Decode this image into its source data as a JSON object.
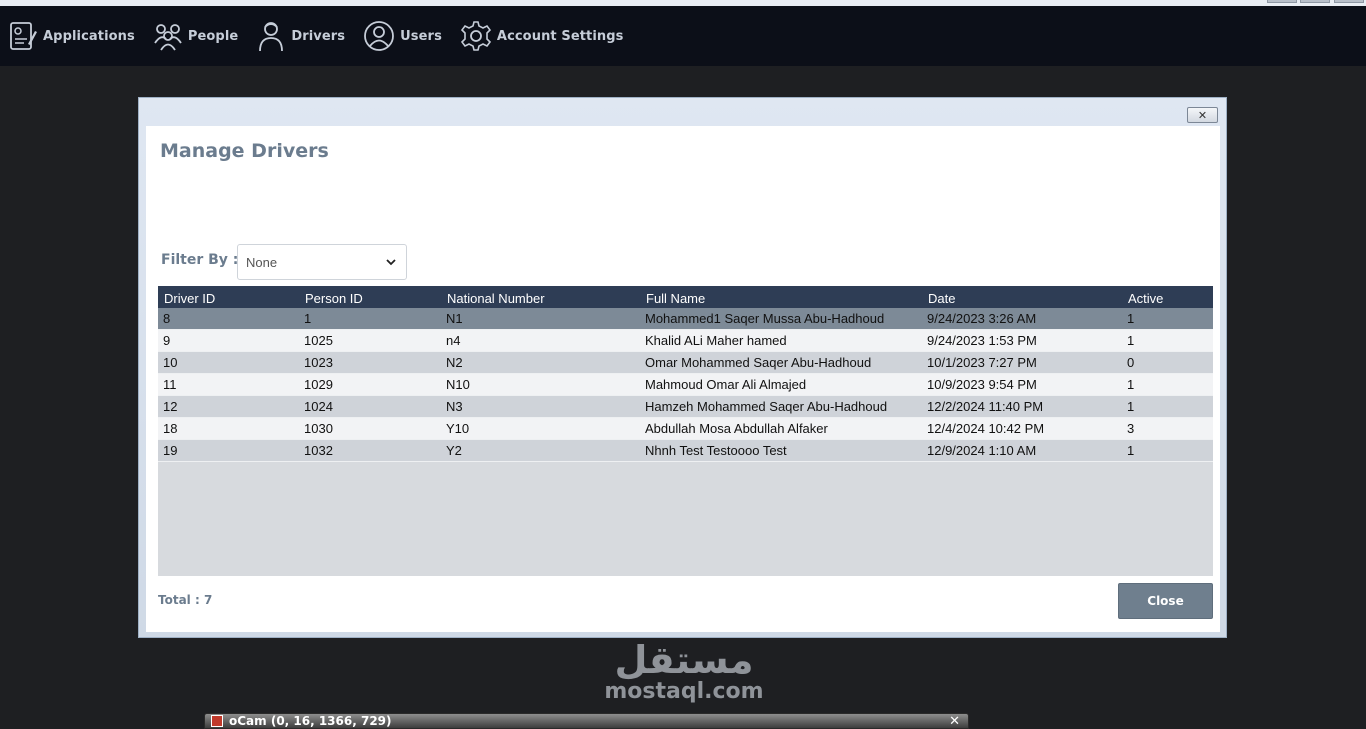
{
  "menu": {
    "items": [
      {
        "label": "Applications",
        "icon": "applications-icon"
      },
      {
        "label": "People",
        "icon": "people-icon"
      },
      {
        "label": "Drivers",
        "icon": "driver-icon"
      },
      {
        "label": "Users",
        "icon": "user-icon"
      },
      {
        "label": "Account Settings",
        "icon": "gear-icon"
      }
    ]
  },
  "dialog": {
    "title": "Manage Drivers",
    "close_x": "✕",
    "filter": {
      "label": "Filter By :",
      "selected": "None"
    },
    "table": {
      "columns": [
        "Driver ID",
        "Person ID",
        "National Number",
        "Full Name",
        "Date",
        "Active"
      ],
      "rows": [
        [
          "8",
          "1",
          "N1",
          "Mohammed1 Saqer Mussa Abu-Hadhoud",
          "9/24/2023 3:26 AM",
          "1"
        ],
        [
          "9",
          "1025",
          "n4",
          "Khalid ALi Maher hamed",
          "9/24/2023 1:53 PM",
          "1"
        ],
        [
          "10",
          "1023",
          "N2",
          "Omar Mohammed Saqer Abu-Hadhoud",
          "10/1/2023 7:27 PM",
          "0"
        ],
        [
          "11",
          "1029",
          "N10",
          "Mahmoud Omar Ali Almajed",
          "10/9/2023 9:54 PM",
          "1"
        ],
        [
          "12",
          "1024",
          "N3",
          "Hamzeh Mohammed Saqer Abu-Hadhoud",
          "12/2/2024 11:40 PM",
          "1"
        ],
        [
          "18",
          "1030",
          "Y10",
          "Abdullah Mosa Abdullah Alfaker",
          "12/4/2024 10:42 PM",
          "3"
        ],
        [
          "19",
          "1032",
          "Y2",
          "Nhnh Test Testoooo Test",
          "12/9/2024 1:10 AM",
          "1"
        ]
      ]
    },
    "total_label": "Total : 7",
    "close_button": "Close"
  },
  "watermark": {
    "arabic": "مستقل",
    "latin": "mostaql.com"
  },
  "ocam": {
    "title": "oCam (0, 16, 1366, 729)",
    "close": "✕"
  },
  "colors": {
    "menubar": "#0c0f18",
    "grid_header": "#2e3d55",
    "selected_row": "#7d8a97",
    "close_button": "#6f7f8e",
    "title_text": "#6b7c8e"
  }
}
